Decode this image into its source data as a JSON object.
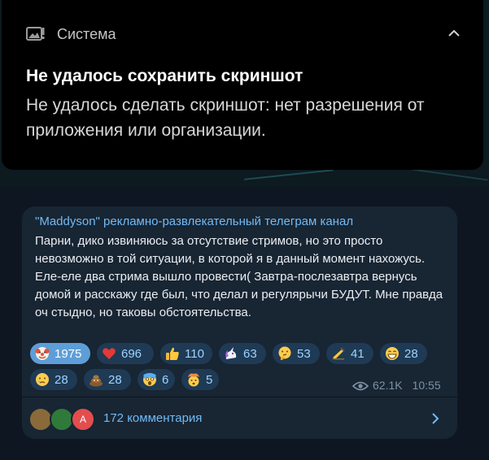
{
  "notification": {
    "app_name": "Система",
    "title": "Не удалось сохранить скриншот",
    "body": "Не удалось сделать скриншот: нет разрешения от приложения или организации."
  },
  "message": {
    "sender": "\"Maddyson\" рекламно-развлекательный телеграм канал",
    "text": "Парни, дико извиняюсь за отсутствие стримов, но это просто невозможно в той ситуации, в которой я в данный момент нахожусь. Еле-еле два стрима вышло провести( Завтра-послезавтра вернусь домой и расскажу где был, что делал и регулярычи БУДУТ. Мне правда оч стыдно, но таковы обстоятельства.",
    "views": "62.1K",
    "time": "10:55",
    "comments_label": "172 комментария",
    "avatar_letter": "А"
  },
  "reactions": [
    {
      "emoji": "clown-face",
      "count": "1975",
      "mine": true
    },
    {
      "emoji": "red-heart",
      "count": "696"
    },
    {
      "emoji": "thumbs-up",
      "count": "110"
    },
    {
      "emoji": "unicorn",
      "count": "63"
    },
    {
      "emoji": "thinking-face",
      "count": "53"
    },
    {
      "emoji": "writing-hand",
      "count": "41"
    },
    {
      "emoji": "grinning-face",
      "count": "28"
    },
    {
      "emoji": "crying-face",
      "count": "28"
    },
    {
      "emoji": "pile-of-poo",
      "count": "28"
    },
    {
      "emoji": "screaming-face",
      "count": "6"
    },
    {
      "emoji": "exploding-head",
      "count": "5"
    }
  ]
}
